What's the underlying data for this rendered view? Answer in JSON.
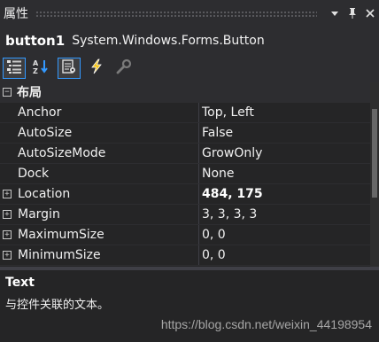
{
  "panel": {
    "title": "属性"
  },
  "object": {
    "name": "button1",
    "type": "System.Windows.Forms.Button"
  },
  "toolbar": {
    "buttons": [
      {
        "icon": "categorized-icon",
        "active": true
      },
      {
        "icon": "alphabetical-icon",
        "active": false
      },
      {
        "icon": "properties-icon",
        "active": true
      },
      {
        "icon": "events-icon",
        "active": false
      },
      {
        "icon": "property-pages-icon",
        "active": false
      }
    ]
  },
  "grid": {
    "category": {
      "label": "布局",
      "expander": "−"
    },
    "rows": [
      {
        "name": "Anchor",
        "value": "Top, Left",
        "bold": false
      },
      {
        "name": "AutoSize",
        "value": "False",
        "bold": false
      },
      {
        "name": "AutoSizeMode",
        "value": "GrowOnly",
        "bold": false
      },
      {
        "name": "Dock",
        "value": "None",
        "bold": false
      },
      {
        "name": "Location",
        "value": "484, 175",
        "bold": true,
        "expander": "+"
      },
      {
        "name": "Margin",
        "value": "3, 3, 3, 3",
        "bold": false,
        "expander": "+"
      },
      {
        "name": "MaximumSize",
        "value": "0, 0",
        "bold": false,
        "expander": "+"
      },
      {
        "name": "MinimumSize",
        "value": "0, 0",
        "bold": false,
        "expander": "+"
      }
    ]
  },
  "description": {
    "title": "Text",
    "text": "与控件关联的文本。"
  },
  "watermark": "https://blog.csdn.net/weixin_44198954",
  "colors": {
    "accent": "#3399ff",
    "background": "#2d2d30",
    "grid": "#252526"
  }
}
